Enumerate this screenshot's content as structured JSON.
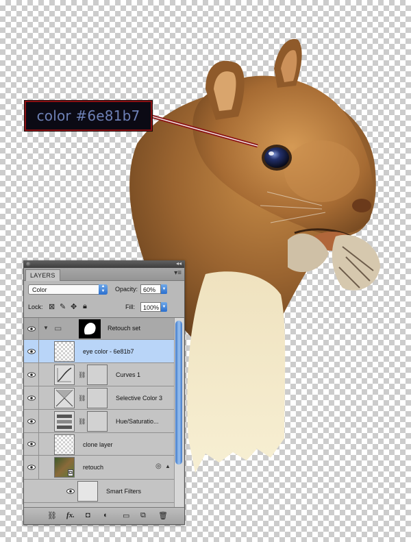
{
  "callout": {
    "text": "color #6e81b7",
    "text_color": "#6e81b7",
    "border_color": "#8a0f12"
  },
  "panel": {
    "tab_label": "LAYERS",
    "blend_mode": "Color",
    "opacity_label": "Opacity:",
    "opacity_value": "60%",
    "lock_label": "Lock:",
    "fill_label": "Fill:",
    "fill_value": "100%",
    "layers": [
      {
        "name": "Retouch set",
        "type": "group"
      },
      {
        "name": "eye color - 6e81b7",
        "type": "layer",
        "selected": true
      },
      {
        "name": "Curves 1",
        "type": "adjustment"
      },
      {
        "name": "Selective Color 3",
        "type": "adjustment"
      },
      {
        "name": "Hue/Saturatio...",
        "type": "adjustment"
      },
      {
        "name": "clone layer",
        "type": "layer"
      },
      {
        "name": "retouch",
        "type": "smart-object"
      },
      {
        "name": "Smart Filters",
        "type": "smart-filters"
      }
    ],
    "bottom_icons": [
      "link-icon",
      "fx-icon",
      "mask-icon",
      "adjustment-icon",
      "folder-icon",
      "new-layer-icon",
      "trash-icon"
    ],
    "fx_label": "fx.",
    "selection_color": "#b9d5f8"
  }
}
